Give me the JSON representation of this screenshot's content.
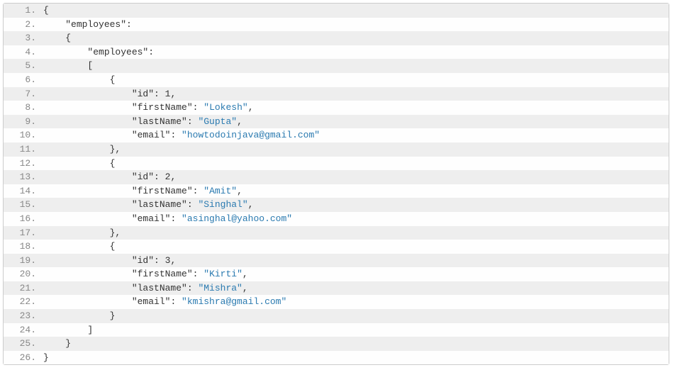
{
  "code_lines": [
    {
      "num": "1.",
      "indent": 0,
      "tokens": [
        {
          "t": "{",
          "c": "p"
        }
      ]
    },
    {
      "num": "2.",
      "indent": 1,
      "tokens": [
        {
          "t": "\"employees\"",
          "c": "k"
        },
        {
          "t": ":",
          "c": "p"
        }
      ]
    },
    {
      "num": "3.",
      "indent": 1,
      "tokens": [
        {
          "t": "{",
          "c": "p"
        }
      ]
    },
    {
      "num": "4.",
      "indent": 2,
      "tokens": [
        {
          "t": "\"employees\"",
          "c": "k"
        },
        {
          "t": ":",
          "c": "p"
        }
      ]
    },
    {
      "num": "5.",
      "indent": 2,
      "tokens": [
        {
          "t": "[",
          "c": "p"
        }
      ]
    },
    {
      "num": "6.",
      "indent": 3,
      "tokens": [
        {
          "t": "{",
          "c": "p"
        }
      ]
    },
    {
      "num": "7.",
      "indent": 4,
      "tokens": [
        {
          "t": "\"id\"",
          "c": "k"
        },
        {
          "t": ": ",
          "c": "p"
        },
        {
          "t": "1",
          "c": "n"
        },
        {
          "t": ",",
          "c": "p"
        }
      ]
    },
    {
      "num": "8.",
      "indent": 4,
      "tokens": [
        {
          "t": "\"firstName\"",
          "c": "k"
        },
        {
          "t": ": ",
          "c": "p"
        },
        {
          "t": "\"Lokesh\"",
          "c": "s"
        },
        {
          "t": ",",
          "c": "p"
        }
      ]
    },
    {
      "num": "9.",
      "indent": 4,
      "tokens": [
        {
          "t": "\"lastName\"",
          "c": "k"
        },
        {
          "t": ": ",
          "c": "p"
        },
        {
          "t": "\"Gupta\"",
          "c": "s"
        },
        {
          "t": ",",
          "c": "p"
        }
      ]
    },
    {
      "num": "10.",
      "indent": 4,
      "tokens": [
        {
          "t": "\"email\"",
          "c": "k"
        },
        {
          "t": ": ",
          "c": "p"
        },
        {
          "t": "\"howtodoinjava@gmail.com\"",
          "c": "s"
        }
      ]
    },
    {
      "num": "11.",
      "indent": 3,
      "tokens": [
        {
          "t": "},",
          "c": "p"
        }
      ]
    },
    {
      "num": "12.",
      "indent": 3,
      "tokens": [
        {
          "t": "{",
          "c": "p"
        }
      ]
    },
    {
      "num": "13.",
      "indent": 4,
      "tokens": [
        {
          "t": "\"id\"",
          "c": "k"
        },
        {
          "t": ": ",
          "c": "p"
        },
        {
          "t": "2",
          "c": "n"
        },
        {
          "t": ",",
          "c": "p"
        }
      ]
    },
    {
      "num": "14.",
      "indent": 4,
      "tokens": [
        {
          "t": "\"firstName\"",
          "c": "k"
        },
        {
          "t": ": ",
          "c": "p"
        },
        {
          "t": "\"Amit\"",
          "c": "s"
        },
        {
          "t": ",",
          "c": "p"
        }
      ]
    },
    {
      "num": "15.",
      "indent": 4,
      "tokens": [
        {
          "t": "\"lastName\"",
          "c": "k"
        },
        {
          "t": ": ",
          "c": "p"
        },
        {
          "t": "\"Singhal\"",
          "c": "s"
        },
        {
          "t": ",",
          "c": "p"
        }
      ]
    },
    {
      "num": "16.",
      "indent": 4,
      "tokens": [
        {
          "t": "\"email\"",
          "c": "k"
        },
        {
          "t": ": ",
          "c": "p"
        },
        {
          "t": "\"asinghal@yahoo.com\"",
          "c": "s"
        }
      ]
    },
    {
      "num": "17.",
      "indent": 3,
      "tokens": [
        {
          "t": "},",
          "c": "p"
        }
      ]
    },
    {
      "num": "18.",
      "indent": 3,
      "tokens": [
        {
          "t": "{",
          "c": "p"
        }
      ]
    },
    {
      "num": "19.",
      "indent": 4,
      "tokens": [
        {
          "t": "\"id\"",
          "c": "k"
        },
        {
          "t": ": ",
          "c": "p"
        },
        {
          "t": "3",
          "c": "n"
        },
        {
          "t": ",",
          "c": "p"
        }
      ]
    },
    {
      "num": "20.",
      "indent": 4,
      "tokens": [
        {
          "t": "\"firstName\"",
          "c": "k"
        },
        {
          "t": ": ",
          "c": "p"
        },
        {
          "t": "\"Kirti\"",
          "c": "s"
        },
        {
          "t": ",",
          "c": "p"
        }
      ]
    },
    {
      "num": "21.",
      "indent": 4,
      "tokens": [
        {
          "t": "\"lastName\"",
          "c": "k"
        },
        {
          "t": ": ",
          "c": "p"
        },
        {
          "t": "\"Mishra\"",
          "c": "s"
        },
        {
          "t": ",",
          "c": "p"
        }
      ]
    },
    {
      "num": "22.",
      "indent": 4,
      "tokens": [
        {
          "t": "\"email\"",
          "c": "k"
        },
        {
          "t": ": ",
          "c": "p"
        },
        {
          "t": "\"kmishra@gmail.com\"",
          "c": "s"
        }
      ]
    },
    {
      "num": "23.",
      "indent": 3,
      "tokens": [
        {
          "t": "}",
          "c": "p"
        }
      ]
    },
    {
      "num": "24.",
      "indent": 2,
      "tokens": [
        {
          "t": "]",
          "c": "p"
        }
      ]
    },
    {
      "num": "25.",
      "indent": 1,
      "tokens": [
        {
          "t": "}",
          "c": "p"
        }
      ]
    },
    {
      "num": "26.",
      "indent": 0,
      "tokens": [
        {
          "t": "}",
          "c": "p"
        }
      ]
    }
  ],
  "indent_unit": "    "
}
